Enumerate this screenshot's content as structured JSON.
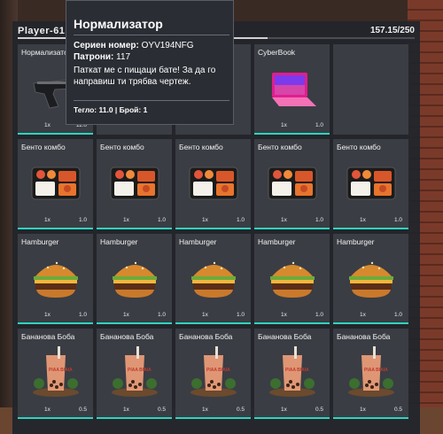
{
  "player": {
    "name": "Player-61"
  },
  "inventory": {
    "weight": "157.15/250",
    "weight_fraction": 0.6286
  },
  "tooltip": {
    "title": "Нормализатор",
    "serial_label": "Сериен номер:",
    "serial_value": "OYV194NFG",
    "ammo_label": "Патрони:",
    "ammo_value": "117",
    "description": "Паткат ме с пищаци бате! За да го направиш ти трябва чертеж.",
    "footer": "Тегло: 11.0 | Брой: 1"
  },
  "slots_row1": [
    {
      "name": "Нормализатор",
      "qty": "1x",
      "weight": "11.0",
      "icon": "pistol-icon"
    },
    {
      "name": "",
      "qty": "",
      "weight": "",
      "icon": ""
    },
    {
      "name": "",
      "qty": "",
      "weight": "",
      "icon": ""
    },
    {
      "name": "CyberBook",
      "qty": "1x",
      "weight": "1.0",
      "icon": "laptop-icon"
    },
    {
      "name": "",
      "qty": "",
      "weight": "",
      "icon": ""
    }
  ],
  "slots_row2": [
    {
      "name": "Бенто комбо",
      "qty": "1x",
      "weight": "1.0",
      "icon": "bento-icon"
    },
    {
      "name": "Бенто комбо",
      "qty": "1x",
      "weight": "1.0",
      "icon": "bento-icon"
    },
    {
      "name": "Бенто комбо",
      "qty": "1x",
      "weight": "1.0",
      "icon": "bento-icon"
    },
    {
      "name": "Бенто комбо",
      "qty": "1x",
      "weight": "1.0",
      "icon": "bento-icon"
    },
    {
      "name": "Бенто комбо",
      "qty": "1x",
      "weight": "1.0",
      "icon": "bento-icon"
    }
  ],
  "slots_row3": [
    {
      "name": "Hamburger",
      "qty": "1x",
      "weight": "1.0",
      "icon": "burger-icon"
    },
    {
      "name": "Hamburger",
      "qty": "1x",
      "weight": "1.0",
      "icon": "burger-icon"
    },
    {
      "name": "Hamburger",
      "qty": "1x",
      "weight": "1.0",
      "icon": "burger-icon"
    },
    {
      "name": "Hamburger",
      "qty": "1x",
      "weight": "1.0",
      "icon": "burger-icon"
    },
    {
      "name": "Hamburger",
      "qty": "1x",
      "weight": "1.0",
      "icon": "burger-icon"
    }
  ],
  "slots_row4": [
    {
      "name": "Бананова Боба",
      "qty": "1x",
      "weight": "0.5",
      "icon": "boba-icon",
      "cup_text": "PIAA BIAIA"
    },
    {
      "name": "Бананова Боба",
      "qty": "1x",
      "weight": "0.5",
      "icon": "boba-icon",
      "cup_text": "PIAA BIAIA"
    },
    {
      "name": "Бананова Боба",
      "qty": "1x",
      "weight": "0.5",
      "icon": "boba-icon",
      "cup_text": "PIAA BIAIA"
    },
    {
      "name": "Бананова Боба",
      "qty": "1x",
      "weight": "0.5",
      "icon": "boba-icon",
      "cup_text": "PIAA BIAIA"
    },
    {
      "name": "Бананова Боба",
      "qty": "1x",
      "weight": "0.5",
      "icon": "boba-icon",
      "cup_text": "PIAA BIAIA"
    }
  ],
  "colors": {
    "accent": "#2dd4bf",
    "panel": "#22252c",
    "slot": "#3a3d44"
  }
}
